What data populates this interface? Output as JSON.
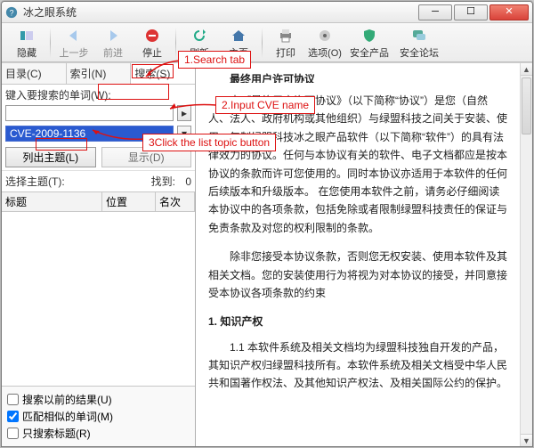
{
  "window": {
    "title": "冰之眼系统"
  },
  "toolbar": {
    "hide": "隐藏",
    "back": "上一步",
    "forward": "前进",
    "stop": "停止",
    "refresh": "刷新",
    "home": "主页",
    "print": "打印",
    "options": "选项(O)",
    "product": "安全产品",
    "forum": "安全论坛"
  },
  "sidebar": {
    "tabs": {
      "contents": "目录(C)",
      "index": "索引(N)",
      "search": "搜索(S)"
    },
    "search_label": "键入要搜索的单词(W):",
    "search_value": "",
    "cve_value": "CVE-2009-1136",
    "list_topics": "列出主题(L)",
    "display": "显示(D)",
    "select_topic": "选择主题(T):",
    "found_label": "找到:",
    "found_count": "0",
    "cols": {
      "title": "标题",
      "pos": "位置",
      "rank": "名次"
    },
    "checks": {
      "prev": "搜索以前的结果(U)",
      "similar": "匹配相似的单词(M)",
      "title_only": "只搜索标题(R)"
    },
    "checked": {
      "prev": false,
      "similar": true,
      "title_only": false
    }
  },
  "doc": {
    "title": "最终用户许可协议",
    "p1": "本《最终用户许可协议》（以下简称“协议”）是您（自然人、法人、政府机构或其他组织）与绿盟科技之间关于安装、使用、复制绿盟科技冰之眼产品软件（以下简称“软件”）的具有法律效力的协议。任何与本协议有关的软件、电子文档都应是按本协议的条款而许可您使用的。同时本协议亦适用于本软件的任何后续版本和升级版本。   在您使用本软件之前，请务必仔细阅读本协议中的各项条款，包括免除或者限制绿盟科技责任的保证与免责条款及对您的权利限制的条款。",
    "p2": "除非您接受本协议条款，否则您无权安装、使用本软件及其相关文档。您的安装使用行为将视为对本协议的接受，并同意接受本协议各项条款的约束",
    "h1": "1.   知识产权",
    "p3": "1.1 本软件系统及相关文档均为绿盟科技独自开发的产品，其知识产权归绿盟科技所有。本软件系统及相关文档受中华人民共和国著作权法、及其他知识产权法、及相关国际公约的保护。"
  },
  "annotations": {
    "a1": "1.Search tab",
    "a2": "2.Input CVE name",
    "a3": "3Click the list topic button"
  },
  "icons": {
    "app": "app-icon",
    "hide": "hide-icon",
    "back": "back-arrow-icon",
    "forward": "forward-arrow-icon",
    "stop": "stop-icon",
    "refresh": "refresh-icon",
    "home": "home-icon",
    "print": "print-icon",
    "options": "options-icon",
    "product": "shield-icon",
    "forum": "forum-icon"
  }
}
